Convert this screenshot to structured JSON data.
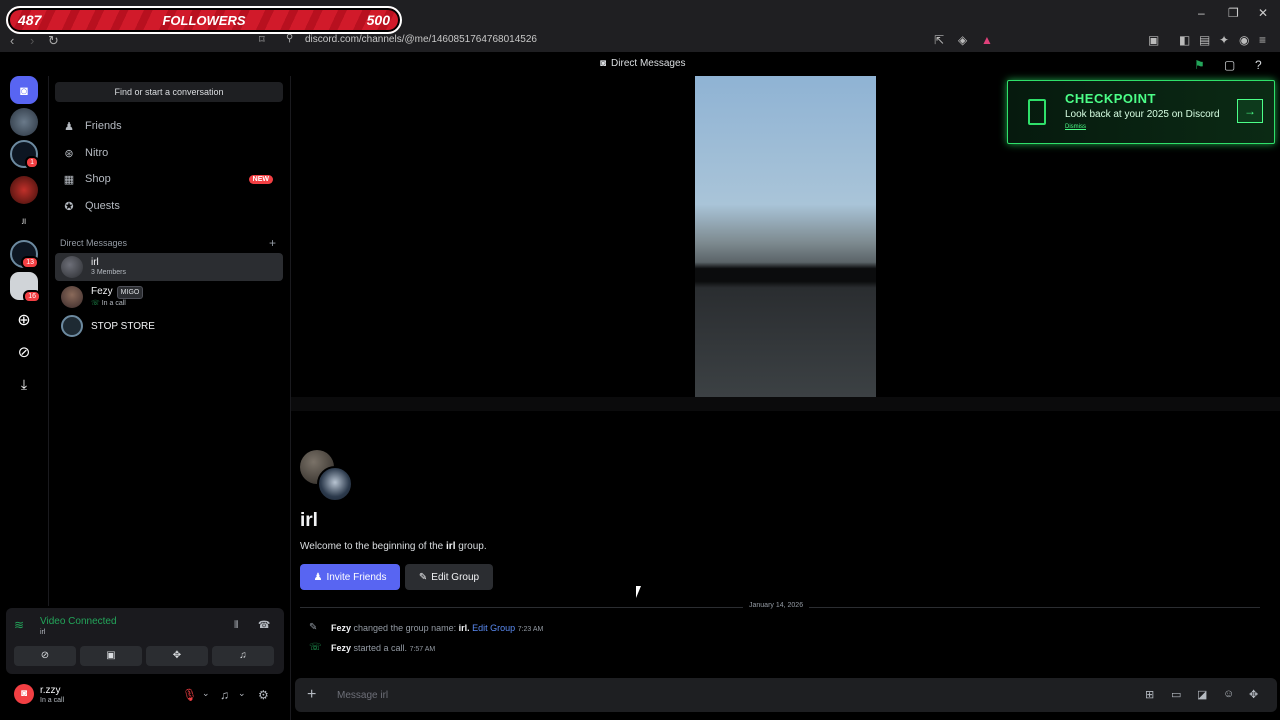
{
  "overlay": {
    "left": "487",
    "mid": "FOLLOWERS",
    "right": "500"
  },
  "browser": {
    "url": "discord.com/channels/@me/1460851764768014526",
    "controls": {
      "minimize": "–",
      "maximize": "❐",
      "close": "✕"
    }
  },
  "titlebar": {
    "title": "Direct Messages"
  },
  "servers": [
    {
      "badge": ""
    },
    {
      "badge": "1"
    },
    {
      "badge": ""
    },
    {
      "badge": ""
    },
    {
      "badge": "13"
    },
    {
      "badge": "16"
    }
  ],
  "sidebar": {
    "search": "Find or start a conversation",
    "nav": [
      {
        "label": "Friends",
        "icon": "friends-icon"
      },
      {
        "label": "Nitro",
        "icon": "nitro-icon"
      },
      {
        "label": "Shop",
        "icon": "shop-icon",
        "badge": "NEW"
      },
      {
        "label": "Quests",
        "icon": "quests-icon"
      }
    ],
    "dm_header": "Direct Messages",
    "dms": [
      {
        "name": "irl",
        "sub": "3 Members"
      },
      {
        "name": "Fezy",
        "tag": "MIGO",
        "sub": "In a call"
      },
      {
        "name": "STOP STORE",
        "sub": ""
      }
    ]
  },
  "voice": {
    "status": "Video Connected",
    "channel": "irl"
  },
  "user": {
    "name": "r.zzy",
    "status": "In a call"
  },
  "main": {
    "group_title": "irl",
    "welcome_prefix": "Welcome to the beginning of the ",
    "welcome_name": "irl",
    "welcome_suffix": " group.",
    "invite_button": "Invite Friends",
    "edit_button": "Edit Group",
    "date": "January 14, 2026",
    "messages": [
      {
        "user": "Fezy",
        "text": "changed the group name:",
        "value": "irl.",
        "link": "Edit Group",
        "time": "7:23 AM"
      },
      {
        "user": "Fezy",
        "text": "started a call.",
        "time": "7:57 AM"
      }
    ],
    "input_placeholder": "Message irl"
  },
  "checkpoint": {
    "title": "CHECKPOINT",
    "subtitle": "Look back at your 2025 on Discord",
    "dismiss": "Dismiss"
  },
  "colors": {
    "brand": "#5865f2",
    "green": "#23a55a",
    "red": "#f23f43",
    "checkpoint": "#4cff88"
  }
}
